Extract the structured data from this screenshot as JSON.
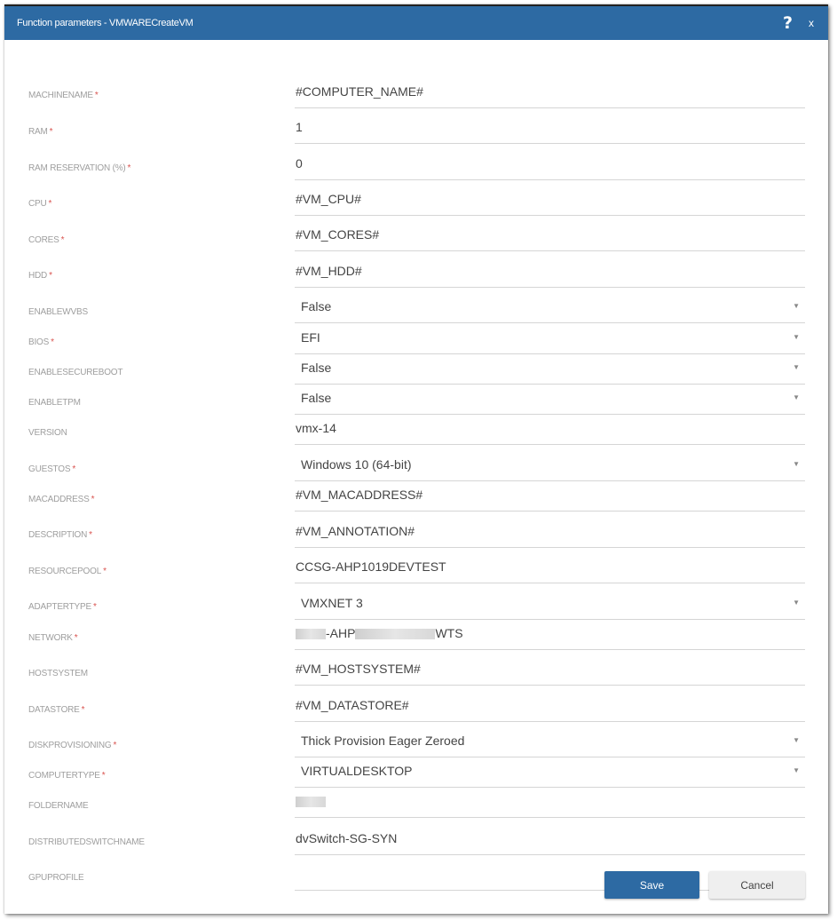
{
  "header": {
    "title": "Function parameters - VMWARECreateVM",
    "help_icon": "?",
    "close_icon": "x"
  },
  "fields": [
    {
      "label": "MACHINENAME",
      "required": true,
      "type": "text",
      "value": "#COMPUTER_NAME#"
    },
    {
      "label": "RAM",
      "required": true,
      "type": "text",
      "value": "1"
    },
    {
      "label": "RAM RESERVATION (%)",
      "required": true,
      "type": "text",
      "value": "0"
    },
    {
      "label": "CPU",
      "required": true,
      "type": "text",
      "value": "#VM_CPU#"
    },
    {
      "label": "CORES",
      "required": true,
      "type": "text",
      "value": "#VM_CORES#"
    },
    {
      "label": "HDD",
      "required": true,
      "type": "text",
      "value": "#VM_HDD#"
    },
    {
      "label": "ENABLEWVBS",
      "required": false,
      "type": "select",
      "value": "False"
    },
    {
      "label": "BIOS",
      "required": true,
      "type": "select",
      "value": "EFI"
    },
    {
      "label": "ENABLESECUREBOOT",
      "required": false,
      "type": "select",
      "value": "False"
    },
    {
      "label": "ENABLETPM",
      "required": false,
      "type": "select",
      "value": "False"
    },
    {
      "label": "VERSION",
      "required": false,
      "type": "text",
      "value": "vmx-14"
    },
    {
      "label": "GUESTOS",
      "required": true,
      "type": "select",
      "value": "Windows 10 (64-bit)"
    },
    {
      "label": "MACADDRESS",
      "required": true,
      "type": "text",
      "value": "#VM_MACADDRESS#"
    },
    {
      "label": "DESCRIPTION",
      "required": true,
      "type": "text",
      "value": "#VM_ANNOTATION#"
    },
    {
      "label": "RESOURCEPOOL",
      "required": true,
      "type": "text",
      "value": "CCSG-AHP1019DEVTEST"
    },
    {
      "label": "ADAPTERTYPE",
      "required": true,
      "type": "select",
      "value": "VMXNET 3"
    },
    {
      "label": "NETWORK",
      "required": true,
      "type": "text",
      "value": "-AHP",
      "value_suffix": "WTS",
      "redacted": true
    },
    {
      "label": "HOSTSYSTEM",
      "required": false,
      "type": "text",
      "value": "#VM_HOSTSYSTEM#"
    },
    {
      "label": "DATASTORE",
      "required": true,
      "type": "text",
      "value": "#VM_DATASTORE#"
    },
    {
      "label": "DISKPROVISIONING",
      "required": true,
      "type": "select",
      "value": "Thick Provision Eager Zeroed"
    },
    {
      "label": "COMPUTERTYPE",
      "required": true,
      "type": "select",
      "value": "VIRTUALDESKTOP"
    },
    {
      "label": "FOLDERNAME",
      "required": false,
      "type": "text",
      "value": "",
      "redacted": true
    },
    {
      "label": "DISTRIBUTEDSWITCHNAME",
      "required": false,
      "type": "text",
      "value": "dvSwitch-SG-SYN"
    },
    {
      "label": "GPUPROFILE",
      "required": false,
      "type": "text",
      "value": ""
    }
  ],
  "required_marker": "*",
  "dropdown_arrow": "▼",
  "buttons": {
    "save": "Save",
    "cancel": "Cancel"
  },
  "colors": {
    "header_bg": "#2d6aa3",
    "required": "#d9534f",
    "label": "#9e9e9e"
  }
}
